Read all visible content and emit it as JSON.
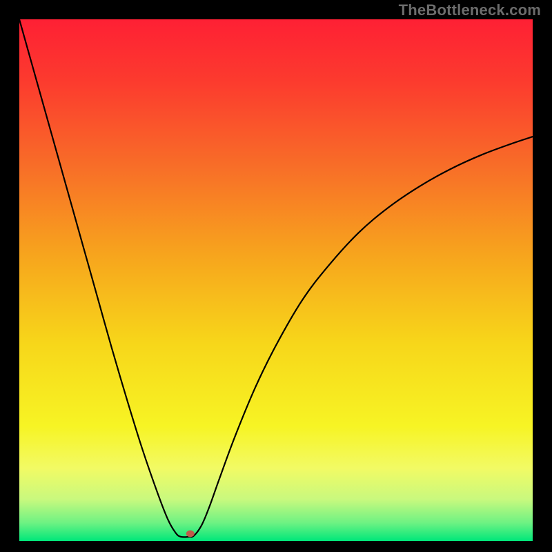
{
  "watermark": "TheBottleneck.com",
  "chart_data": {
    "type": "line",
    "title": "",
    "xlabel": "",
    "ylabel": "",
    "xlim": [
      0,
      100
    ],
    "ylim": [
      0,
      100
    ],
    "background_gradient": {
      "stops": [
        {
          "pos": 0.0,
          "color": "#fe2034"
        },
        {
          "pos": 0.12,
          "color": "#fc3b2e"
        },
        {
          "pos": 0.28,
          "color": "#f86d28"
        },
        {
          "pos": 0.45,
          "color": "#f7a41d"
        },
        {
          "pos": 0.62,
          "color": "#f7d61a"
        },
        {
          "pos": 0.78,
          "color": "#f7f424"
        },
        {
          "pos": 0.86,
          "color": "#f2fa64"
        },
        {
          "pos": 0.92,
          "color": "#c9f97e"
        },
        {
          "pos": 0.965,
          "color": "#6ef283"
        },
        {
          "pos": 1.0,
          "color": "#00e77a"
        }
      ]
    },
    "series": [
      {
        "name": "bottleneck-curve",
        "color": "#000000",
        "x": [
          0.0,
          3.0,
          6.0,
          9.0,
          12.0,
          15.0,
          18.0,
          21.0,
          24.0,
          27.0,
          29.0,
          30.5,
          31.5,
          33.0,
          34.0,
          35.5,
          37.0,
          39.0,
          42.0,
          46.0,
          50.0,
          55.0,
          60.0,
          66.0,
          72.0,
          78.0,
          84.0,
          90.0,
          96.0,
          100.0
        ],
        "y": [
          100.0,
          89.5,
          79.0,
          68.5,
          58.0,
          47.5,
          37.0,
          27.0,
          17.5,
          9.0,
          4.0,
          1.5,
          0.8,
          0.8,
          1.0,
          3.0,
          6.5,
          12.0,
          20.0,
          29.5,
          37.5,
          46.0,
          52.5,
          59.0,
          64.0,
          68.0,
          71.3,
          74.0,
          76.2,
          77.5
        ]
      }
    ],
    "marker": {
      "x": 33.3,
      "y": 1.4,
      "color": "#c05a4a",
      "radius_px": 6
    }
  }
}
